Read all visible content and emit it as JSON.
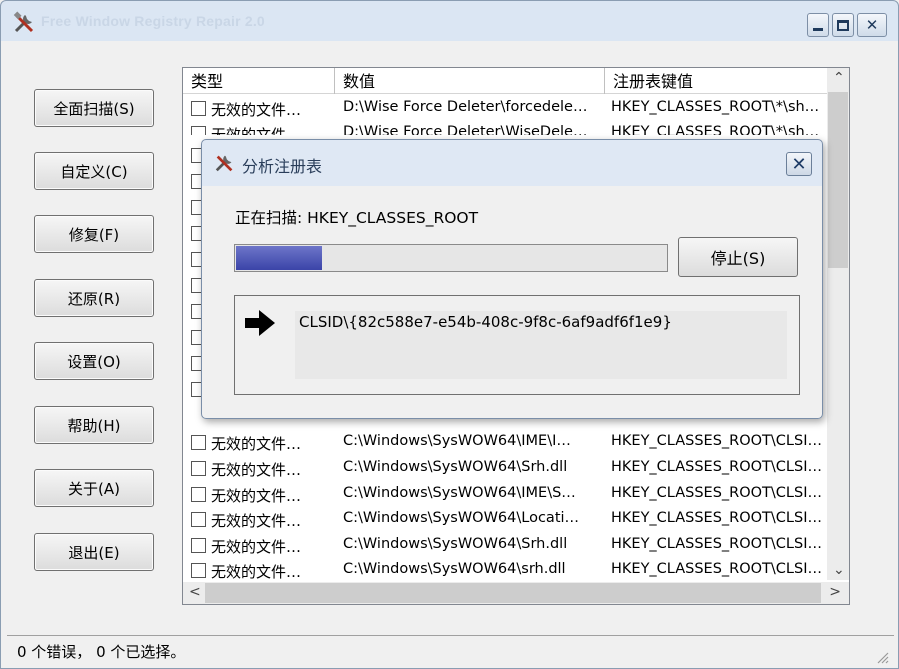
{
  "window": {
    "title": "Free Window Registry Repair 2.0"
  },
  "side_buttons": [
    {
      "label": "全面扫描(S)"
    },
    {
      "label": "自定义(C)"
    },
    {
      "label": "修复(F)"
    },
    {
      "label": "还原(R)"
    },
    {
      "label": "设置(O)"
    },
    {
      "label": "帮助(H)"
    },
    {
      "label": "关于(A)"
    },
    {
      "label": "退出(E)"
    }
  ],
  "list": {
    "columns": [
      "类型",
      "数值",
      "注册表键值"
    ],
    "rows": [
      {
        "type": "无效的文件…",
        "value": "D:\\Wise Force Deleter\\forcedele…",
        "key": "HKEY_CLASSES_ROOT\\*\\sh…"
      },
      {
        "type": "无效的文件…",
        "value": "D:\\Wise Force Deleter\\WiseDele…",
        "key": "HKEY_CLASSES_ROOT\\*\\sh…"
      },
      {
        "type": "无效的文件…",
        "value": "C:\\Windows\\SysWOW64\\IME\\I…",
        "key": "HKEY_CLASSES_ROOT\\CLSI…"
      },
      {
        "type": "无效的文件…",
        "value": "C:\\Windows\\SysWOW64\\Srh.dll",
        "key": "HKEY_CLASSES_ROOT\\CLSI…"
      },
      {
        "type": "无效的文件…",
        "value": "C:\\Windows\\SysWOW64\\IME\\S…",
        "key": "HKEY_CLASSES_ROOT\\CLSI…"
      },
      {
        "type": "无效的文件…",
        "value": "C:\\Windows\\SysWOW64\\Locati…",
        "key": "HKEY_CLASSES_ROOT\\CLSI…"
      },
      {
        "type": "无效的文件…",
        "value": "C:\\Windows\\SysWOW64\\Srh.dll",
        "key": "HKEY_CLASSES_ROOT\\CLSI…"
      },
      {
        "type": "无效的文件…",
        "value": "C:\\Windows\\SysWOW64\\srh.dll",
        "key": "HKEY_CLASSES_ROOT\\CLSI…"
      }
    ]
  },
  "status": {
    "text": "0 个错误，  0 个已选择。"
  },
  "dialog": {
    "title": "分析注册表",
    "scanning_label": "正在扫描: HKEY_CLASSES_ROOT",
    "progress": 0.2,
    "stop_label": "停止(S)",
    "current_path": "CLSID\\{82c588e7-e54b-408c-9f8c-6af9adf6f1e9}"
  },
  "colors": {
    "progress": "#3b44a8",
    "titlebar": "#dbe6f3"
  },
  "icons": {
    "app": "tools-icon",
    "arrow": "right-arrow-icon"
  }
}
